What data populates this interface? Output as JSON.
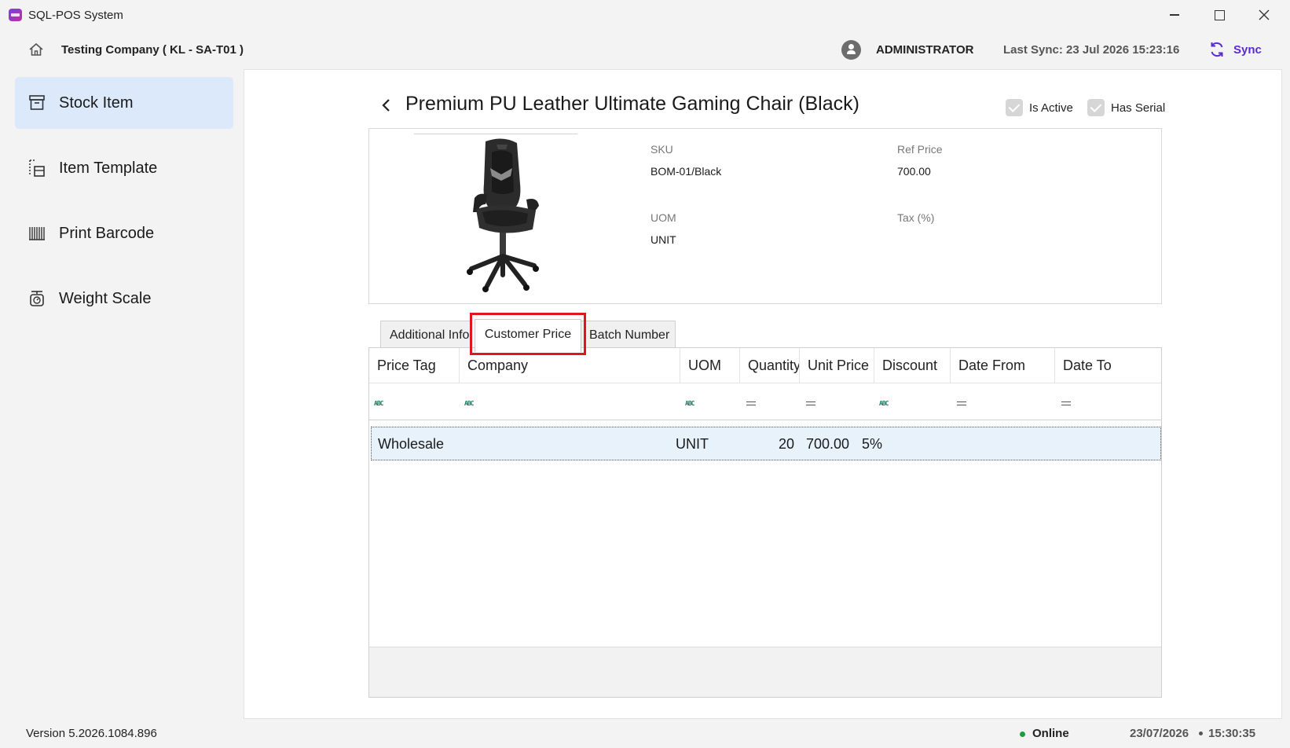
{
  "window": {
    "title": "SQL-POS System"
  },
  "header": {
    "company": "Testing Company ( KL - SA-T01 )",
    "user": "ADMINISTRATOR",
    "last_sync": "Last Sync: 23 Jul 2026 15:23:16",
    "sync_label": "Sync"
  },
  "sidebar": {
    "items": [
      {
        "label": "Stock Item",
        "icon": "archive-box-icon",
        "active": true
      },
      {
        "label": "Item Template",
        "icon": "item-template-icon",
        "active": false
      },
      {
        "label": "Print Barcode",
        "icon": "barcode-icon",
        "active": false
      },
      {
        "label": "Weight Scale",
        "icon": "weight-scale-icon",
        "active": false
      }
    ],
    "version": "Version 5.2026.1084.896"
  },
  "item": {
    "title": "Premium PU Leather Ultimate Gaming Chair (Black)",
    "is_active_label": "Is Active",
    "is_active": true,
    "has_serial_label": "Has Serial",
    "has_serial": true,
    "fields": {
      "sku_label": "SKU",
      "sku": "BOM-01/Black",
      "ref_price_label": "Ref Price",
      "ref_price": "700.00",
      "uom_label": "UOM",
      "uom": "UNIT",
      "tax_label": "Tax (%)",
      "tax": ""
    }
  },
  "tabs": [
    {
      "label": "Additional Info"
    },
    {
      "label": "Customer Price",
      "selected": true
    },
    {
      "label": "Batch Number"
    }
  ],
  "grid": {
    "columns": [
      "Price Tag",
      "Company",
      "UOM",
      "Quantity",
      "Unit Price",
      "Discount",
      "Date From",
      "Date To"
    ],
    "rows": [
      {
        "price_tag": "Wholesale",
        "company": "",
        "uom": "UNIT",
        "quantity": "20",
        "unit_price": "700.00",
        "discount": "5%",
        "date_from": "",
        "date_to": ""
      }
    ]
  },
  "status": {
    "connection": "Online",
    "date": "23/07/2026",
    "time": "15:30:35"
  },
  "colors": {
    "accent": "#5a2bd1",
    "active_nav": "#dce9fb",
    "highlight_box": "#e0161e",
    "online": "#1f9d3d",
    "selected_row": "#e8f2fb"
  }
}
